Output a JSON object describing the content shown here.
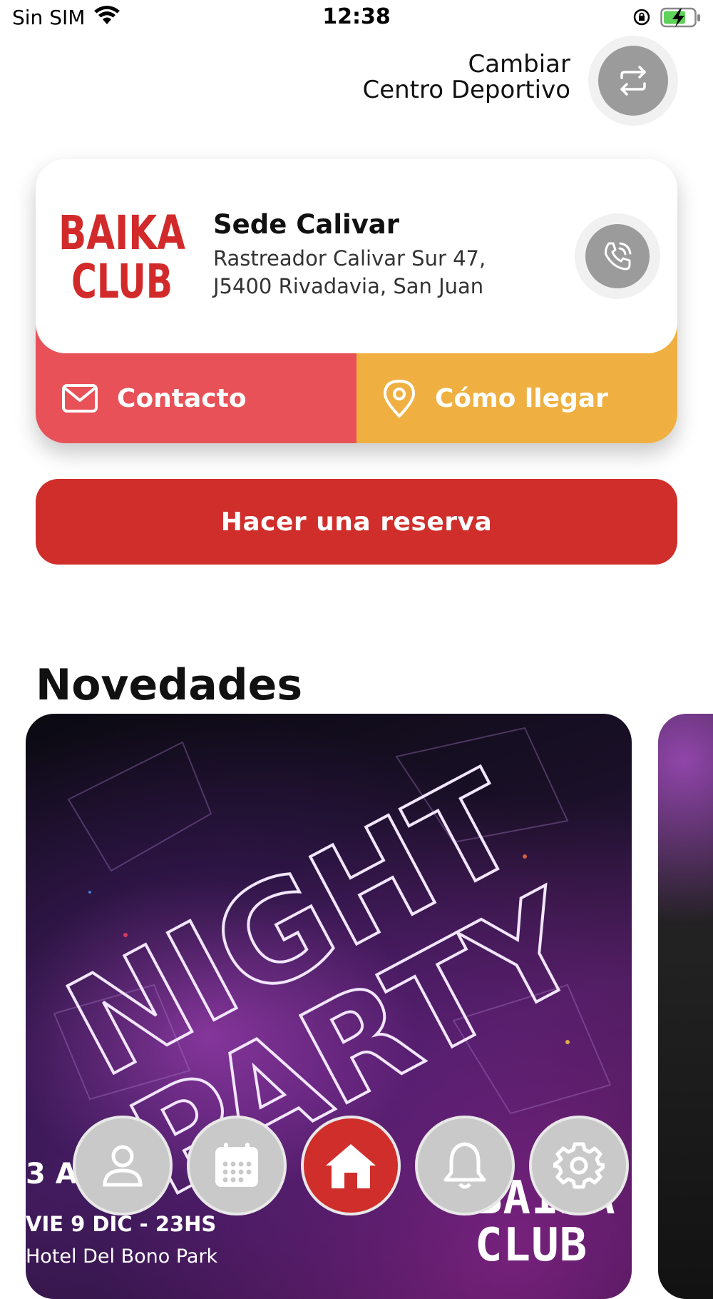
{
  "status_bar": {
    "carrier": "Sin SIM",
    "time": "12:38"
  },
  "header": {
    "change_center_line1": "Cambiar",
    "change_center_line2": "Centro Deportivo",
    "change_icon": "swap-arrows-icon"
  },
  "club_card": {
    "logo_text_line1": "BAIKA",
    "logo_text_line2": "CLUB",
    "name": "Sede Calivar",
    "address_line1": "Rastreador Calivar Sur 47,",
    "address_line2": "J5400 Rivadavia, San Juan",
    "phone_icon": "phone-icon",
    "contact_label": "Contacto",
    "directions_label": "Cómo llegar",
    "colors": {
      "contact": "#e85157",
      "directions": "#efb041"
    }
  },
  "reserve": {
    "label": "Hacer una reserva",
    "color": "#cf2e2b"
  },
  "news": {
    "title": "Novedades",
    "cards": [
      {
        "headline_line1": "NIGHT",
        "headline_line2": "PARTY",
        "line1": "3 A",
        "line2": "VIE 9 DIC - 23HS",
        "line3": "Hotel Del Bono Park",
        "logo_line1": "BAIKA",
        "logo_line2": "CLUB"
      },
      {}
    ]
  },
  "bottom_nav": {
    "items": [
      {
        "icon": "user-icon",
        "active": false
      },
      {
        "icon": "calendar-icon",
        "active": false
      },
      {
        "icon": "home-icon",
        "active": true
      },
      {
        "icon": "bell-icon",
        "active": false
      },
      {
        "icon": "gear-icon",
        "active": false
      }
    ]
  }
}
